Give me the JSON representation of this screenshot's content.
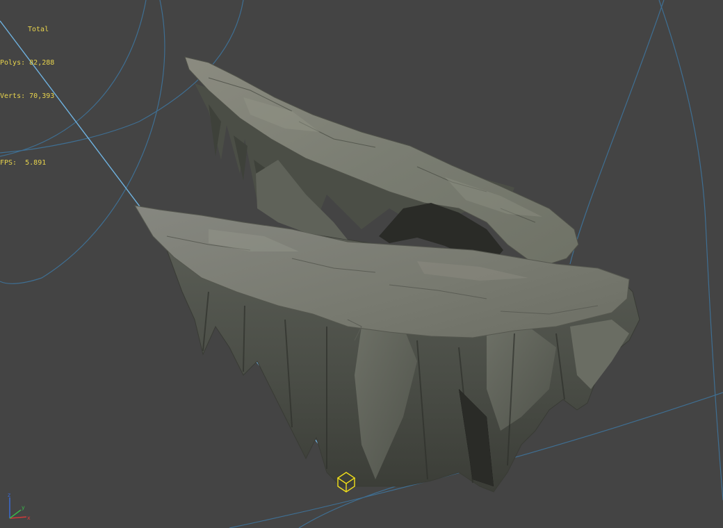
{
  "viewport": {
    "background": "#444444",
    "stats": {
      "title": "Total",
      "polys_label": "Polys:",
      "polys_value": "82,288",
      "verts_label": "Verts:",
      "verts_value": "70,393",
      "fps_label": "FPS:",
      "fps_value": "5.891",
      "text_color": "#e8d44d"
    },
    "axes": {
      "x_label": "x",
      "y_label": "y",
      "z_label": "z",
      "x_color": "#d23a3a",
      "y_color": "#3ab84a",
      "z_color": "#3a6ad2"
    },
    "object": {
      "name": "floating-rock-island",
      "rock_color": "#6a6c60",
      "pivot_color": "#f2e019"
    },
    "light_line_color": "#5aa3d6"
  }
}
